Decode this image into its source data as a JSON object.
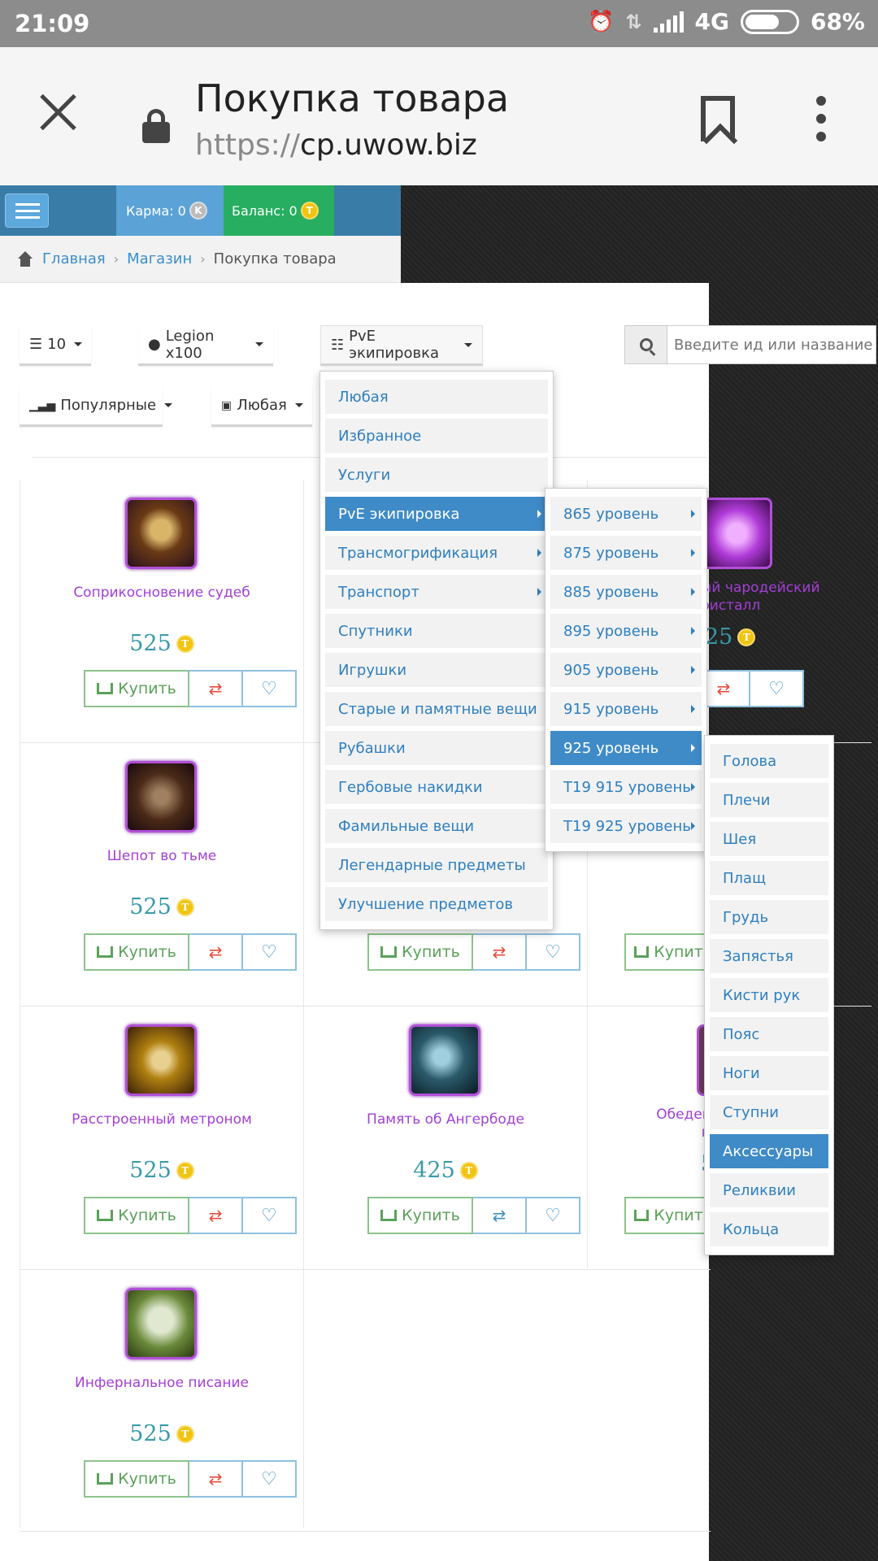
{
  "status": {
    "time": "21:09",
    "network": "4G",
    "battery": "68%",
    "battery_level": 0.68
  },
  "browser": {
    "title": "Покупка товара",
    "url_proto": "https://",
    "url_host": "cp.uwow.biz"
  },
  "nav": {
    "karma_label": "Карма: 0",
    "karma_coin": "K",
    "balance_label": "Баланс: 0",
    "balance_coin": "T"
  },
  "breadcrumb": {
    "home": "Главная",
    "shop": "Магазин",
    "current": "Покупка товара",
    "sep": "›"
  },
  "filters": {
    "per_page": "10",
    "realm": "Legion x100",
    "category": "PvE экипировка",
    "sort": "Популярные",
    "currency": "Любая",
    "search_placeholder": "Введите ид или название"
  },
  "products": [
    {
      "name": "Соприкосновение судеб",
      "price": "525",
      "icon_color": "#6a3a14"
    },
    {
      "name": "Шепот во тьме",
      "price": "525",
      "icon_color": "#4a2a18"
    },
    {
      "name": "Расстроенный метроном",
      "price": "525",
      "icon_color": "#8a6a10"
    },
    {
      "name": "Память об Ангербоде",
      "price": "425",
      "icon_color": "#1e3a4a"
    },
    {
      "name": "Инфернальное писание",
      "price": "525",
      "icon_color": "#5a7a2a"
    },
    {
      "name": "ый чародейский\nристалл",
      "price": "25",
      "icon_color": "#b03ad8"
    },
    {
      "name": "Обеденн\nма",
      "price": "5",
      "icon_color": "#6a3a5a"
    }
  ],
  "buttons": {
    "buy": "Купить",
    "cmp": "⇄",
    "fav": "♡"
  },
  "menu_category": [
    "Любая",
    "Избранное",
    "Услуги",
    "PvE экипировка",
    "Трансмогрификация",
    "Транспорт",
    "Спутники",
    "Игрушки",
    "Старые и памятные вещи",
    "Рубашки",
    "Гербовые накидки",
    "Фамильные вещи",
    "Легендарные предметы",
    "Улучшение предметов"
  ],
  "menu_level": [
    "865 уровень",
    "875 уровень",
    "885 уровень",
    "895 уровень",
    "905 уровень",
    "915 уровень",
    "925 уровень",
    "T19 915 уровень",
    "T19 925 уровень"
  ],
  "menu_slot": [
    "Голова",
    "Плечи",
    "Шея",
    "Плащ",
    "Грудь",
    "Запястья",
    "Кисти рук",
    "Пояс",
    "Ноги",
    "Ступни",
    "Аксессуары",
    "Реликвии",
    "Кольца"
  ],
  "colors": {
    "accent": "#3f8bc8",
    "product_name": "#a33fd6",
    "price": "#3a9aa8",
    "buy": "#5aa15a",
    "compare": "#e74c3c"
  }
}
